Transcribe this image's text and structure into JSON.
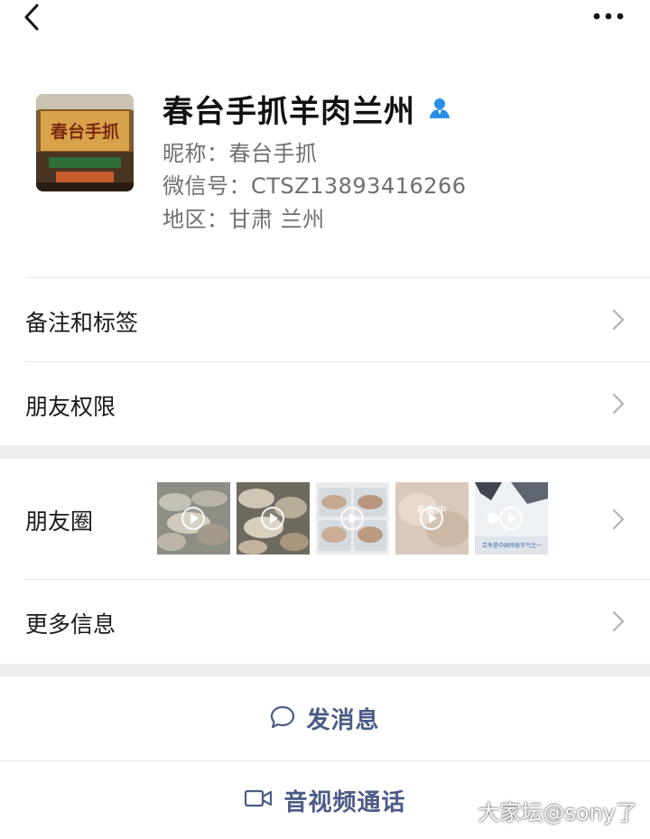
{
  "profile": {
    "name": "春台手抓羊肉兰州",
    "nickname_line": "昵称：春台手抓",
    "wechat_id_line": "微信号：CTSZ13893416266",
    "region_line": "地区：甘肃 兰州",
    "avatar_sign_text": "春台手抓"
  },
  "menu": {
    "remarks_label": "备注和标签",
    "permissions_label": "朋友权限",
    "moments_label": "朋友圈",
    "more_info_label": "更多信息"
  },
  "moments": {
    "thumb_count_visible": 5,
    "thumb4_overlay_text": "春食 中",
    "thumb5_caption": "立冬是中国传统节气之一"
  },
  "actions": {
    "message_label": "发消息",
    "call_label": "音视频通话"
  },
  "watermark": "大家坛@sony了",
  "colors": {
    "accent": "#4b5b86",
    "verified": "#2a8ee6",
    "separator": "#ededed",
    "secondary_text": "#6f6f6f"
  },
  "icons": [
    "back-arrow-icon",
    "more-dots-icon",
    "verified-user-icon",
    "chevron-right-icon",
    "play-icon",
    "chat-bubble-icon",
    "video-camera-icon"
  ]
}
